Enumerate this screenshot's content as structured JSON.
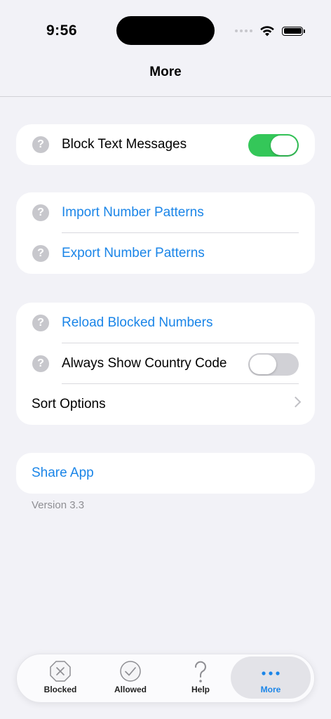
{
  "status_bar": {
    "time": "9:56"
  },
  "header": {
    "title": "More"
  },
  "section1": {
    "block_text": {
      "label": "Block Text Messages",
      "on": true
    }
  },
  "section2": {
    "import_label": "Import Number Patterns",
    "export_label": "Export Number Patterns"
  },
  "section3": {
    "reload_label": "Reload Blocked Numbers",
    "country_code": {
      "label": "Always Show Country Code",
      "on": false
    },
    "sort_label": "Sort Options"
  },
  "section4": {
    "share_label": "Share App"
  },
  "version": "Version 3.3",
  "tabbar": {
    "tabs": [
      {
        "label": "Blocked",
        "icon": "x-octagon-icon"
      },
      {
        "label": "Allowed",
        "icon": "checkmark-circle-icon"
      },
      {
        "label": "Help",
        "icon": "question-icon"
      },
      {
        "label": "More",
        "icon": "ellipsis-icon",
        "active": true
      }
    ]
  },
  "colors": {
    "accent": "#1A85E8",
    "toggle_on": "#34C759",
    "background": "#F2F2F7"
  }
}
